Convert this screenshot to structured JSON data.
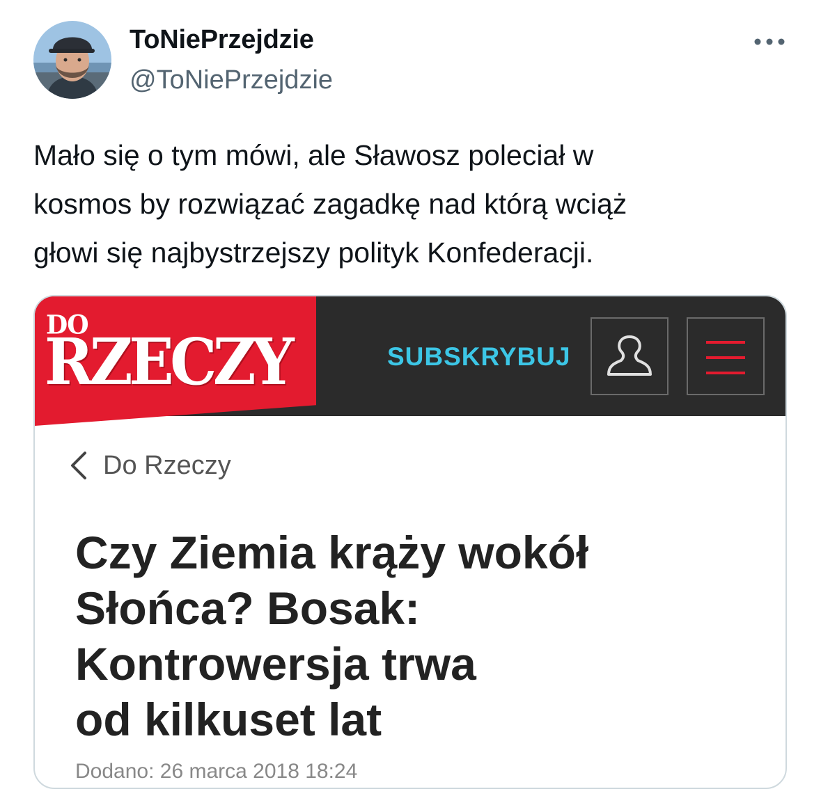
{
  "tweet": {
    "display_name": "ToNiePrzejdzie",
    "handle": "@ToNiePrzejdzie",
    "text_lines": [
      "Mało się o tym mówi, ale Sławosz poleciał w",
      "kosmos by rozwiązać zagadkę nad którą wciąż",
      "głowi się najbystrzejszy polityk Konfederacji."
    ]
  },
  "embed": {
    "logo_small": "DO",
    "logo_big": "RZECZY",
    "subscribe_label": "SUBSKRYBUJ",
    "back_label": "Do Rzeczy",
    "headline_lines": [
      "Czy Ziemia krąży wokół",
      "Słońca? Bosak:",
      "Kontrowersja trwa",
      "od kilkuset lat"
    ],
    "dateline": "Dodano: 26 marca 2018 18:24"
  },
  "colors": {
    "brand_red": "#e31b2f",
    "header_dark": "#2b2b2b",
    "subscribe_cyan": "#3cc6e6",
    "handle_gray": "#536471"
  },
  "icons": {
    "more": "more-horizontal-icon",
    "user": "user-icon",
    "menu": "hamburger-menu-icon",
    "back": "chevron-left-icon"
  }
}
